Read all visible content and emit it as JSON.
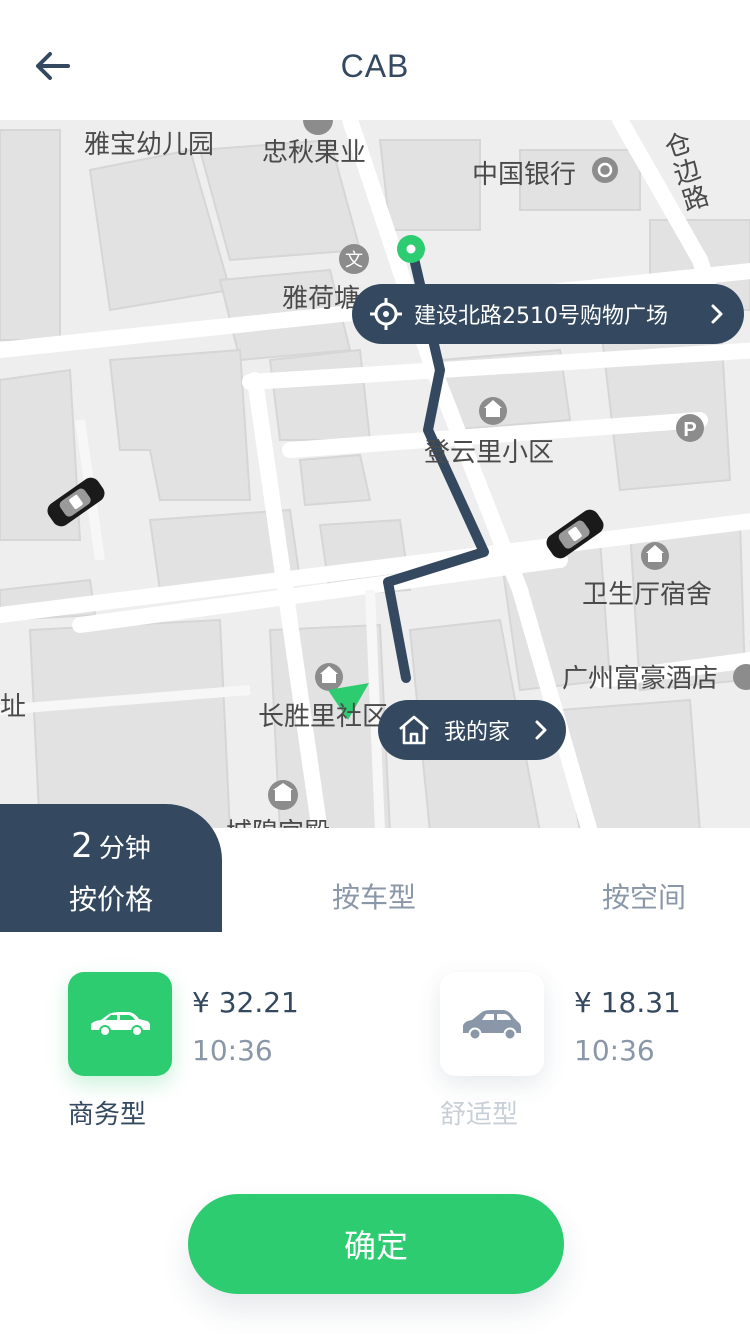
{
  "header": {
    "title": "CAB",
    "back_icon": "arrow-left-icon"
  },
  "map": {
    "labels": {
      "kindergarten": "雅宝幼儿园",
      "fruit": "忠秋果业",
      "bank": "中国银行",
      "road": "仓边路",
      "yahe": "雅荷塘",
      "dengyun": "登云里小区",
      "health": "卫生厅宿舍",
      "hotel": "广州富豪酒店",
      "changsheng": "长胜里社区",
      "site": "遗址",
      "palace": "城隍宫殿"
    },
    "destination": {
      "icon": "crosshair-icon",
      "text": "建设北路2510号购物广场",
      "chevron": "chevron-right-icon"
    },
    "origin": {
      "icon": "home-icon",
      "text": "我的家",
      "chevron": "chevron-right-icon"
    }
  },
  "tabs": {
    "active": {
      "minutes": "2",
      "unit": "分钟",
      "label": "按价格"
    },
    "by_type": "按车型",
    "by_space": "按空间"
  },
  "cars": [
    {
      "name": "商务型",
      "price": "¥ 32.21",
      "time": "10:36",
      "icon": "sedan-icon",
      "selected": true
    },
    {
      "name": "舒适型",
      "price": "¥ 18.31",
      "time": "10:36",
      "icon": "hatchback-icon",
      "selected": false
    }
  ],
  "confirm_label": "确定",
  "colors": {
    "primary": "#344960",
    "accent": "#2ecc71",
    "muted": "#8a97a8"
  }
}
